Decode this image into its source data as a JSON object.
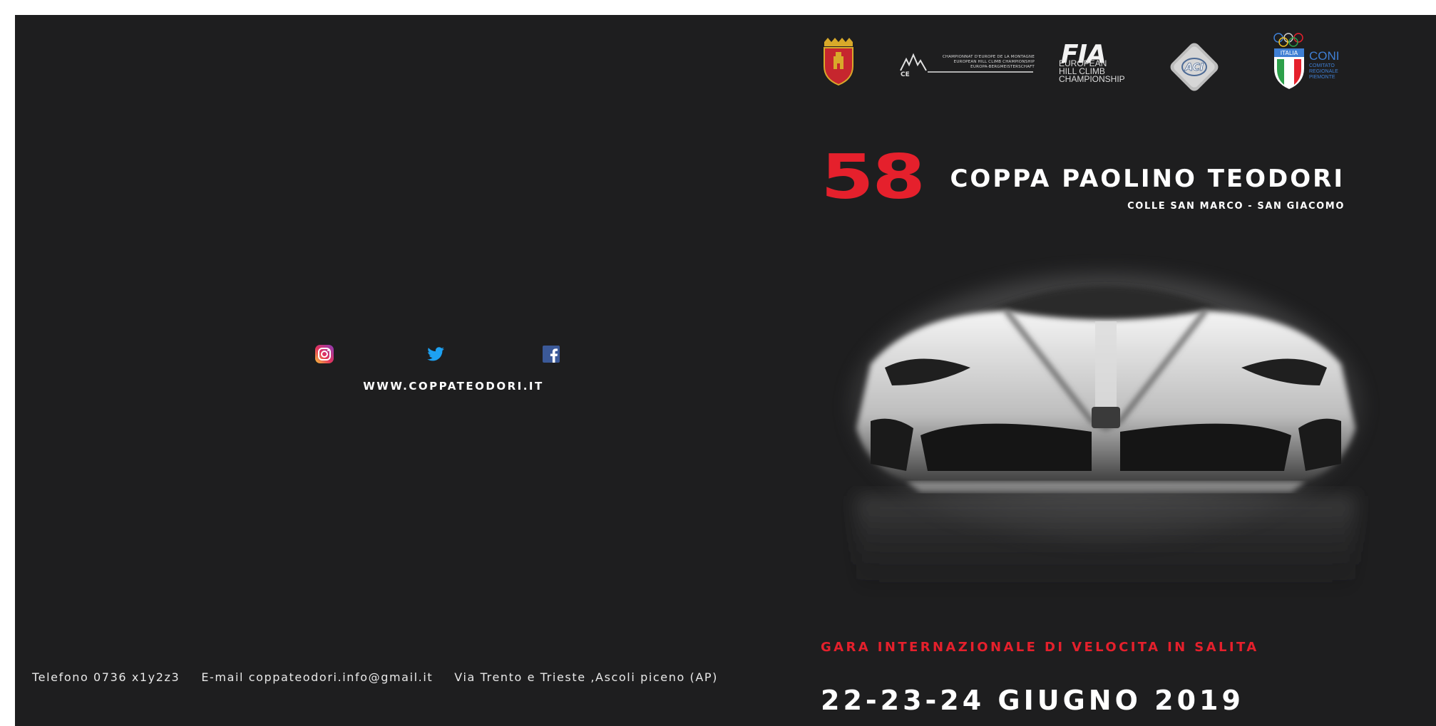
{
  "left_panel": {
    "social": {
      "instagram_icon": "instagram-icon",
      "twitter_icon": "twitter-icon",
      "facebook_icon": "facebook-icon"
    },
    "website": "WWW.COPPATEODORI.IT",
    "contacts": {
      "phone": "Telefono 0736 x1y2z3",
      "email": "E-mail coppateodori.info@gmail.it",
      "address": "Via Trento e Trieste ,Ascoli piceno (AP)"
    }
  },
  "right_panel": {
    "logos": {
      "hill_climb_text": "CHAMPIONNAT D'EUROPE DE LA MONTAGNE\nEUROPEAN HILL CLIMB CHAMPIONSHIP\nEUROPA-BERGMEISTERSCHAFT",
      "fia_mark": "FIA",
      "fia_text": "EUROPEAN\nHILL CLIMB\nCHAMPIONSHIP",
      "coni_mark": "CONI",
      "coni_text": "COMITATO\nREGIONALE\nPIEMONTE",
      "italia_text": "ITALIA"
    },
    "edition": "58",
    "title": "COPPA PAOLINO TEODORI",
    "subtitle": "COLLE SAN MARCO - SAN GIACOMO",
    "race_type": "GARA INTERNAZIONALE DI VELOCITA IN SALITA",
    "dates": "22-23-24 GIUGNO 2019"
  },
  "colors": {
    "background": "#1e1e1f",
    "accent_red": "#e5202c",
    "text": "#ffffff"
  }
}
